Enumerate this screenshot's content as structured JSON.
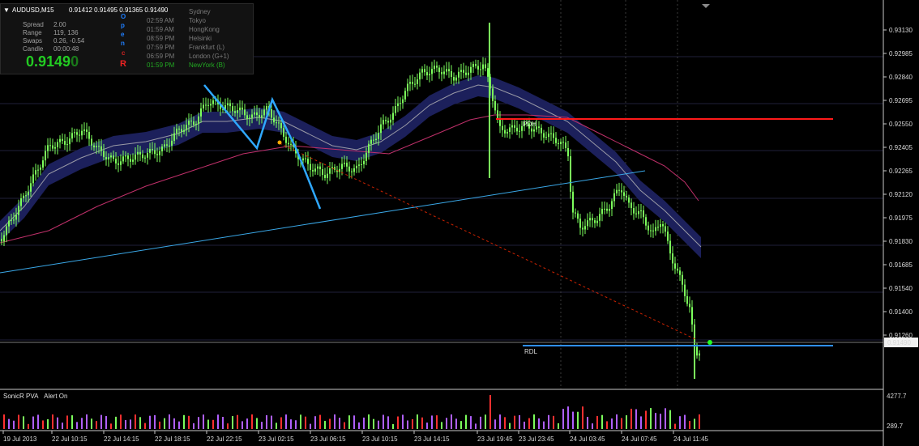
{
  "header": {
    "symbol_label": "AUDUSD,M15",
    "ohlc": "0.91412 0.91495 0.91365 0.91490",
    "arrow": "▼"
  },
  "info_panel": {
    "spread_label": "Spread",
    "spread_value": "2.00",
    "range_label": "Range",
    "range_value": "119, 136",
    "swaps_label": "Swaps",
    "swaps_value": "0.26, -0.54",
    "candle_label": "Candle",
    "candle_value": "00:00:48",
    "big_price_main": "0.9149",
    "big_price_last": "0",
    "big_price_color": "#22cc22",
    "session_letters": [
      "O",
      "p",
      "e",
      "n",
      "c",
      "R"
    ],
    "sessions": [
      {
        "time": "",
        "name": "Sydney",
        "color": "#7a7a7a"
      },
      {
        "time": "02:59 AM",
        "name": "Tokyo",
        "color": "#7a7a7a"
      },
      {
        "time": "01:59 AM",
        "name": "HongKong",
        "color": "#7a7a7a"
      },
      {
        "time": "08:59 PM",
        "name": "Helsinki",
        "color": "#7a7a7a"
      },
      {
        "time": "07:59 PM",
        "name": "Frankfurt  (L)",
        "color": "#7a7a7a"
      },
      {
        "time": "06:59 PM",
        "name": "London  (G+1)",
        "color": "#7a7a7a"
      },
      {
        "time": "01:59 PM",
        "name": "NewYork  (B)",
        "color": "#22aa22"
      }
    ]
  },
  "price_axis": {
    "labels": [
      "0.93130",
      "0.92985",
      "0.92840",
      "0.92695",
      "0.92550",
      "0.92405",
      "0.92265",
      "0.92120",
      "0.91975",
      "0.91830",
      "0.91685",
      "0.91540",
      "0.91400",
      "0.91260"
    ],
    "current_price": "0.91490"
  },
  "time_axis": {
    "labels": [
      "19 Jul 2013",
      "22 Jul 10:15",
      "22 Jul 14:15",
      "22 Jul 18:15",
      "22 Jul 22:15",
      "23 Jul 02:15",
      "23 Jul 06:15",
      "23 Jul 10:15",
      "23 Jul 14:15",
      "23 Jul 19:45",
      "23 Jul 23:45",
      "24 Jul 03:45",
      "24 Jul 07:45",
      "24 Jul 11:45"
    ]
  },
  "annotations": {
    "pdh_label": "PDH",
    "rdl_label": "RDL"
  },
  "indicator_pane": {
    "title": "SonicR PVA",
    "status": "Alert On",
    "scale_top": "4277.7",
    "scale_bottom": "289.7"
  },
  "colors": {
    "background": "#000000",
    "bull_candle": "#7cff5c",
    "channel": "#2a2f6e",
    "ema_slow": "#c0306a",
    "resistance": "#ff0000",
    "support": "#2f8fff",
    "trendline": "#3aa8e8",
    "zigzag": "#2fa8ff",
    "dashed_trend": "#cc2200"
  },
  "chart_data": {
    "type": "candlestick",
    "symbol": "AUDUSD",
    "timeframe": "M15",
    "last_price": 0.9149,
    "x": [
      "19 Jul 2013",
      "22 Jul 10:15",
      "22 Jul 14:15",
      "22 Jul 18:15",
      "22 Jul 22:15",
      "23 Jul 02:15",
      "23 Jul 06:15",
      "23 Jul 10:15",
      "23 Jul 14:15",
      "23 Jul 19:45",
      "23 Jul 23:45",
      "24 Jul 03:45",
      "24 Jul 07:45",
      "24 Jul 11:45"
    ],
    "close": [
      0.9205,
      0.9255,
      0.9258,
      0.9262,
      0.9268,
      0.9255,
      0.9245,
      0.927,
      0.929,
      0.9285,
      0.9265,
      0.9215,
      0.92,
      0.9149
    ],
    "levels": {
      "pdh": 0.9267,
      "rdl": 0.9147
    },
    "ylim": [
      0.912,
      0.932
    ]
  }
}
